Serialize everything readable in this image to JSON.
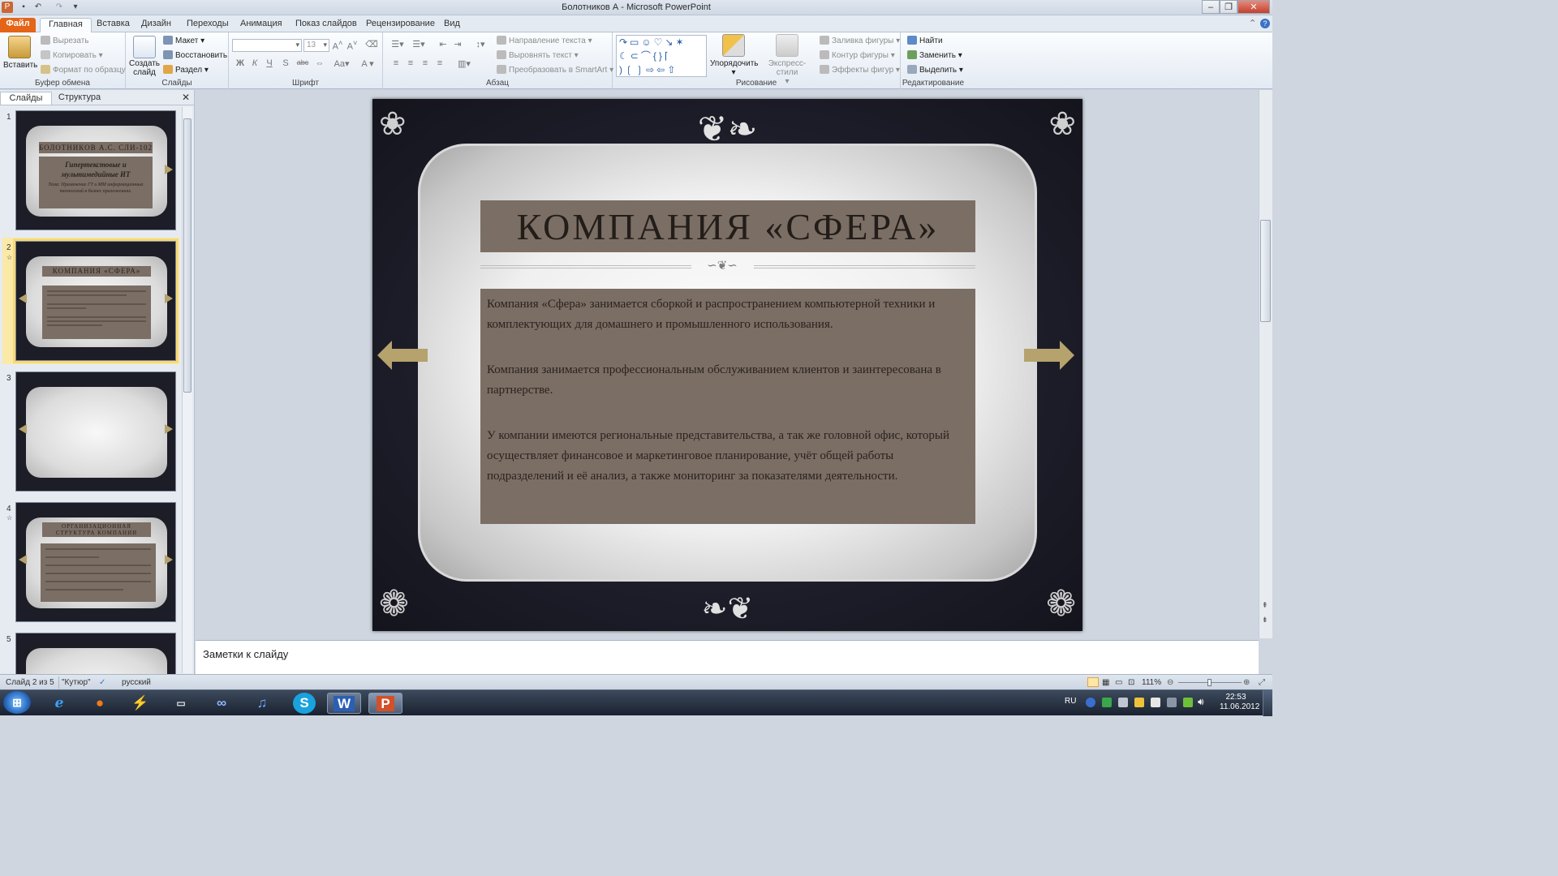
{
  "window": {
    "title": "Болотников А - Microsoft PowerPoint"
  },
  "tabs": [
    "Файл",
    "Главная",
    "Вставка",
    "Дизайн",
    "Переходы",
    "Анимация",
    "Показ слайдов",
    "Рецензирование",
    "Вид"
  ],
  "ribbon": {
    "clipboard": {
      "paste": "Вставить",
      "cut": "Вырезать",
      "copy": "Копировать",
      "format_painter": "Формат по образцу",
      "label": "Буфер обмена"
    },
    "slides": {
      "new_slide": "Создать слайд",
      "layout": "Макет",
      "reset": "Восстановить",
      "section": "Раздел",
      "label": "Слайды"
    },
    "font": {
      "size": "13",
      "bold": "Ж",
      "italic": "К",
      "underline": "Ч",
      "strike": "S",
      "abc": "abc",
      "label": "Шрифт"
    },
    "paragraph": {
      "text_direction": "Направление текста",
      "align_text": "Выровнять текст",
      "smartart": "Преобразовать в SmartArt",
      "label": "Абзац"
    },
    "drawing": {
      "arrange": "Упорядочить",
      "quick_styles": "Экспресс-стили",
      "fill": "Заливка фигуры",
      "outline": "Контур фигуры",
      "effects": "Эффекты фигур",
      "label": "Рисование"
    },
    "editing": {
      "find": "Найти",
      "replace": "Заменить",
      "select": "Выделить",
      "label": "Редактирование"
    }
  },
  "panel": {
    "tab_slides": "Слайды",
    "tab_outline": "Структура"
  },
  "thumbs": {
    "t1_title": "БОЛОТНИКОВ А.С. СЛИ-102",
    "t1_sub": "Гипертекстовые и мультимедийные ИТ",
    "t1_small": "Тема: Применение ГТ и ММ информационных технологий в бизнес приложениях.",
    "t2_title": "КОМПАНИЯ «СФЕРА»",
    "t4_title": "ОРГАНИЗАЦИОННАЯ СТРУКТУРА КОМПАНИИ"
  },
  "slide": {
    "title": "КОМПАНИЯ «СФЕРА»",
    "paragraphs": [
      "Компания «Сфера» занимается сборкой и распространением компьютерной техники и комплектующих для домашнего и промышленного использования.",
      "Компания занимается профессиональным обслуживанием клиентов и заинтересована в партнерстве.",
      "У компании имеются региональные представительства, а так же головной офис, который осуществляет финансовое и маркетинговое планирование, учёт общей работы подразделений и её анализ, а также мониторинг за показателями деятельности."
    ]
  },
  "notes": {
    "placeholder": "Заметки к слайду"
  },
  "status": {
    "slide_of": "Слайд 2 из 5",
    "theme": "\"Кутюр\"",
    "language": "русский",
    "zoom": "111%"
  },
  "taskbar": {
    "lang": "RU",
    "time": "22:53",
    "date": "11.06.2012"
  },
  "colors": {
    "accent_orange": "#e46418",
    "title_bar_fill": "#7b6e65",
    "arrow_gold": "#b5a26d",
    "slide_background": "#1c1d27"
  }
}
